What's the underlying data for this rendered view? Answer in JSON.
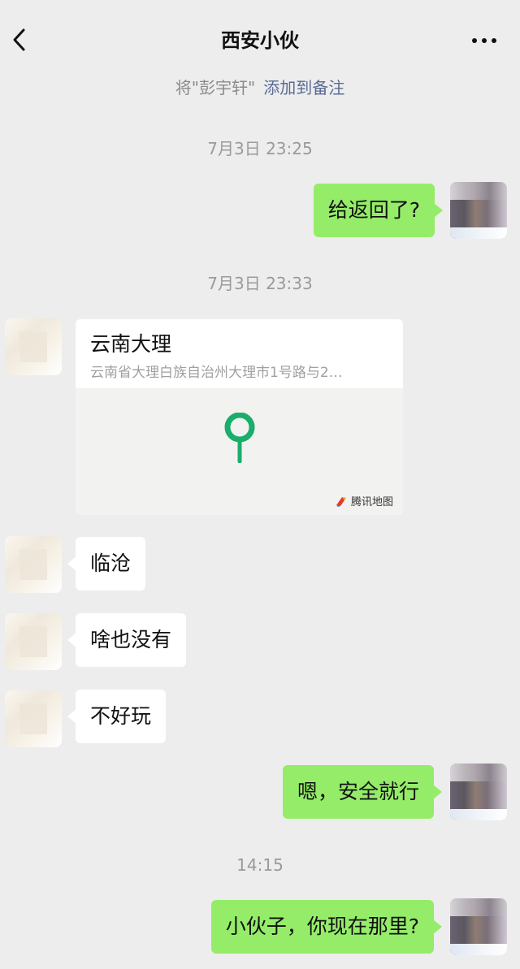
{
  "header": {
    "title": "西安小伙",
    "back_icon": "chevron-left-icon",
    "more_icon": "more-horizontal-icon"
  },
  "remark": {
    "prefix": "将\"彭宇轩\"",
    "link": "添加到备注"
  },
  "messages": {
    "time1": "7月3日 23:25",
    "msg1": "给返回了?",
    "time2": "7月3日 23:33",
    "location": {
      "title": "云南大理",
      "address": "云南省大理白族自治州大理市1号路与2…",
      "map_credit": "腾讯地图",
      "pin_color": "#1aad6b"
    },
    "msg2": "临沧",
    "msg3": "啥也没有",
    "msg4": "不好玩",
    "msg5": "嗯，安全就行",
    "time3": "14:15",
    "msg6": "小伙子，你现在那里?"
  },
  "colors": {
    "background": "#ededed",
    "bubble_sent": "#95ec69",
    "bubble_received": "#ffffff",
    "link": "#5b6b93"
  }
}
